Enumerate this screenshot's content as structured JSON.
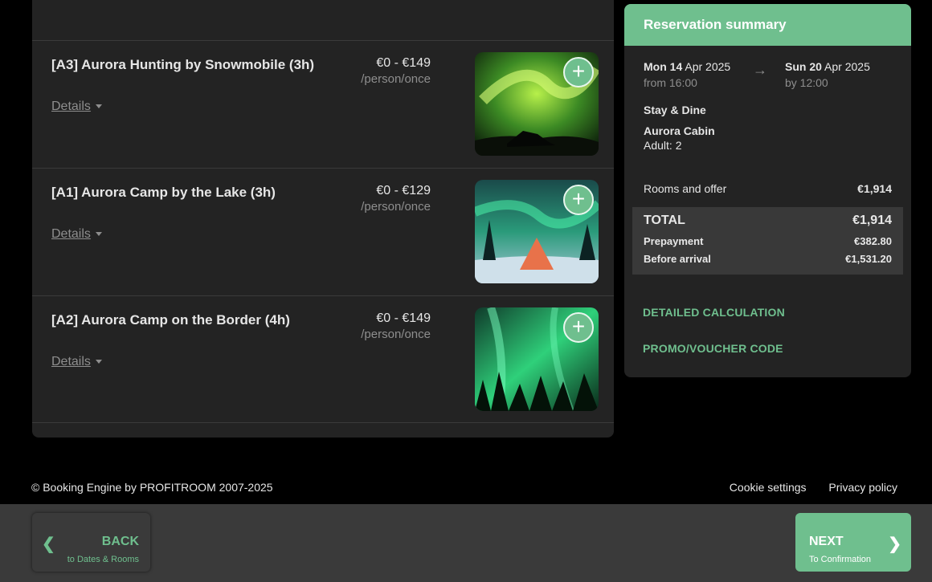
{
  "offers": [
    {
      "title": "[A3] Aurora Hunting by Snowmobile (3h)",
      "price_range": "€0 - €149",
      "price_unit": "/person/once",
      "details_label": "Details",
      "image": "aurora-snowmobile-photo",
      "add_icon": "plus-icon"
    },
    {
      "title": "[A1] Aurora Camp by the Lake (3h)",
      "price_range": "€0 - €129",
      "price_unit": "/person/once",
      "details_label": "Details",
      "image": "aurora-tipi-camp-photo",
      "add_icon": "plus-icon"
    },
    {
      "title": "[A2] Aurora Camp on the Border (4h)",
      "price_range": "€0 - €149",
      "price_unit": "/person/once",
      "details_label": "Details",
      "image": "aurora-forest-photo",
      "add_icon": "plus-icon"
    }
  ],
  "summary": {
    "title": "Reservation summary",
    "checkin": {
      "day": "Mon 14",
      "month_year": "Apr 2025",
      "time": "from 16:00"
    },
    "checkout": {
      "day": "Sun 20",
      "month_year": "Apr 2025",
      "time": "by 12:00"
    },
    "arrow": "→",
    "offer_name": "Stay & Dine",
    "room_name": "Aurora Cabin",
    "guests": "Adult: 2",
    "rooms_label": "Rooms and offer",
    "rooms_value": "€1,914",
    "total_label": "TOTAL",
    "total_value": "€1,914",
    "prepayment_label": "Prepayment",
    "prepayment_value": "€382.80",
    "before_label": "Before arrival",
    "before_value": "€1,531.20",
    "detailed_link": "DETAILED CALCULATION",
    "promo_link": "PROMO/VOUCHER CODE"
  },
  "footer": {
    "copyright": "© Booking Engine by PROFITROOM 2007-2025",
    "cookie": "Cookie settings",
    "privacy": "Privacy policy"
  },
  "nav": {
    "back_label": "BACK",
    "back_sub": "to Dates & Rooms",
    "next_label": "NEXT",
    "next_sub": "To Confirmation"
  },
  "colors": {
    "accent": "#6fbf8e",
    "panel": "#232323",
    "bar": "#3a3a3a"
  }
}
